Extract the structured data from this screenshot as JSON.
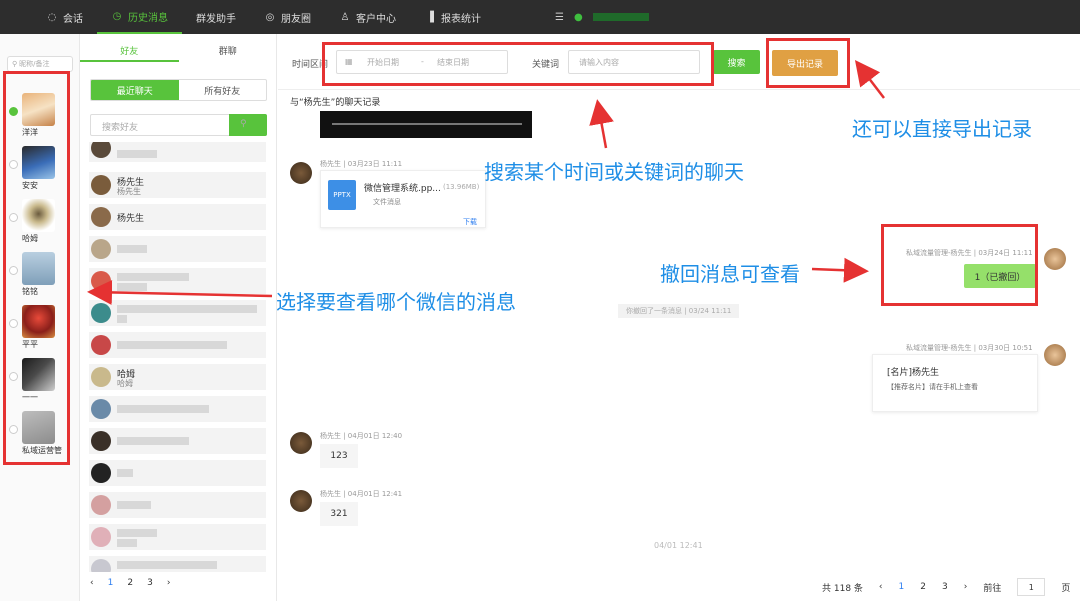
{
  "nav": {
    "items": [
      {
        "label": "会话",
        "icon": "chat-icon"
      },
      {
        "label": "历史消息",
        "icon": "clock-icon",
        "active": true
      },
      {
        "label": "群发助手",
        "icon": ""
      },
      {
        "label": "朋友圈",
        "icon": "globe-icon"
      },
      {
        "label": "客户中心",
        "icon": "user-icon"
      },
      {
        "label": "报表统计",
        "icon": "bar-chart-icon"
      }
    ]
  },
  "accounts": {
    "search_placeholder": "昵称/备注",
    "items": [
      {
        "name": "洋洋",
        "selected": true
      },
      {
        "name": "安安"
      },
      {
        "name": "哈姆"
      },
      {
        "name": "铭铭"
      },
      {
        "name": "平平"
      },
      {
        "name": "一一"
      },
      {
        "name": "私域运营管"
      }
    ]
  },
  "friends": {
    "tabs": [
      "好友",
      "群聊"
    ],
    "toggle": [
      "最近聊天",
      "所有好友"
    ],
    "search_placeholder": "搜索好友",
    "rows": [
      {
        "name": "杨先生",
        "sub": "杨先生"
      },
      {
        "name": "杨先生",
        "sub": ""
      },
      {
        "name": "哈姆",
        "sub": "哈姆"
      }
    ],
    "pager": [
      "1",
      "2",
      "3"
    ]
  },
  "filter": {
    "time_label": "时间区间",
    "start_placeholder": "开始日期",
    "range_sep": "-",
    "end_placeholder": "结束日期",
    "keyword_label": "关键词",
    "keyword_placeholder": "请输入内容",
    "search_btn": "搜索",
    "export_btn": "导出记录"
  },
  "chat": {
    "title": "与“杨先生”的聊天记录",
    "msg1_meta": "杨先生 | 03月23日 11:11",
    "file_name": "微信管理系统.pp...",
    "file_size": "(13.96MB)",
    "file_badge": "PPTX",
    "file_type": "文件消息",
    "file_download": "下载",
    "msg2_meta": "私域流量管理-杨先生 | 03月24日 11:11",
    "msg2_text": "1（已撤回）",
    "sys_note": "你撤回了一条消息 | 03/24 11:11",
    "msg3_meta": "私域流量管理-杨先生 | 03月30日 10:51",
    "card_title": "[名片]杨先生",
    "card_sub": "【推荐名片】请在手机上查看",
    "msg4_meta": "杨先生 | 04月01日 12:40",
    "msg4_text": "123",
    "msg5_meta": "杨先生 | 04月01日 12:41",
    "msg5_text": "321",
    "center_time": "04/01 12:41"
  },
  "pager_right": {
    "total": "共 118 条",
    "pages": [
      "1",
      "2",
      "3"
    ],
    "goto_label": "前往",
    "goto_value": "1",
    "page_unit": "页"
  },
  "annotations": {
    "export": "还可以直接导出记录",
    "search": "搜索某个时间或关键词的聊天",
    "recall": "撤回消息可查看",
    "select": "选择要查看哪个微信的消息"
  },
  "colors": {
    "accent_green": "#58c33c",
    "export_orange": "#e0a043",
    "annotation_red": "#e53232",
    "annotation_blue": "#1e8ee6"
  }
}
